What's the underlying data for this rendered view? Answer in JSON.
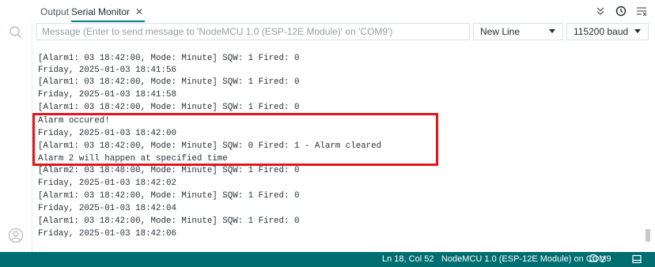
{
  "tabs": {
    "output_label": "Output",
    "serial_label": "Serial Monitor",
    "close_glyph": "✕"
  },
  "toolbar": {
    "icons": [
      "toggle-autoscroll-icon",
      "toggle-timestamp-icon",
      "clear-output-icon"
    ]
  },
  "message": {
    "placeholder": "Message (Enter to send message to 'NodeMCU 1.0 (ESP-12E Module)' on 'COM9')",
    "value": ""
  },
  "line_ending": {
    "selected": "New Line"
  },
  "baud_rate": {
    "selected": "115200 baud"
  },
  "serial_lines": [
    "[Alarm1: 03 18:42:00, Mode: Minute] SQW: 1 Fired: 0",
    "Friday, 2025-01-03 18:41:56",
    "[Alarm1: 03 18:42:00, Mode: Minute] SQW: 1 Fired: 0",
    "Friday, 2025-01-03 18:41:58",
    "[Alarm1: 03 18:42:00, Mode: Minute] SQW: 1 Fired: 0",
    "Alarm occured!",
    "Friday, 2025-01-03 18:42:00",
    "[Alarm1: 03 18:42:00, Mode: Minute] SQW: 0 Fired: 1 - Alarm cleared",
    "Alarm 2 will happen at specified time",
    "[Alarm2: 03 18:48:00, Mode: Minute] SQW: 1 Fired: 0",
    "Friday, 2025-01-03 18:42:02",
    "[Alarm1: 03 18:42:00, Mode: Minute] SQW: 1 Fired: 0",
    "Friday, 2025-01-03 18:42:04",
    "[Alarm1: 03 18:42:00, Mode: Minute] SQW: 1 Fired: 0",
    "Friday, 2025-01-03 18:42:06"
  ],
  "highlight": {
    "color": "#e5141b"
  },
  "status_bar": {
    "position": "Ln 18, Col 52",
    "board": "NodeMCU 1.0 (ESP-12E Module) on COM9",
    "notifications_count": "2"
  },
  "colors": {
    "status_bar_bg": "#006d70",
    "active_tab_underline": "#008184"
  }
}
